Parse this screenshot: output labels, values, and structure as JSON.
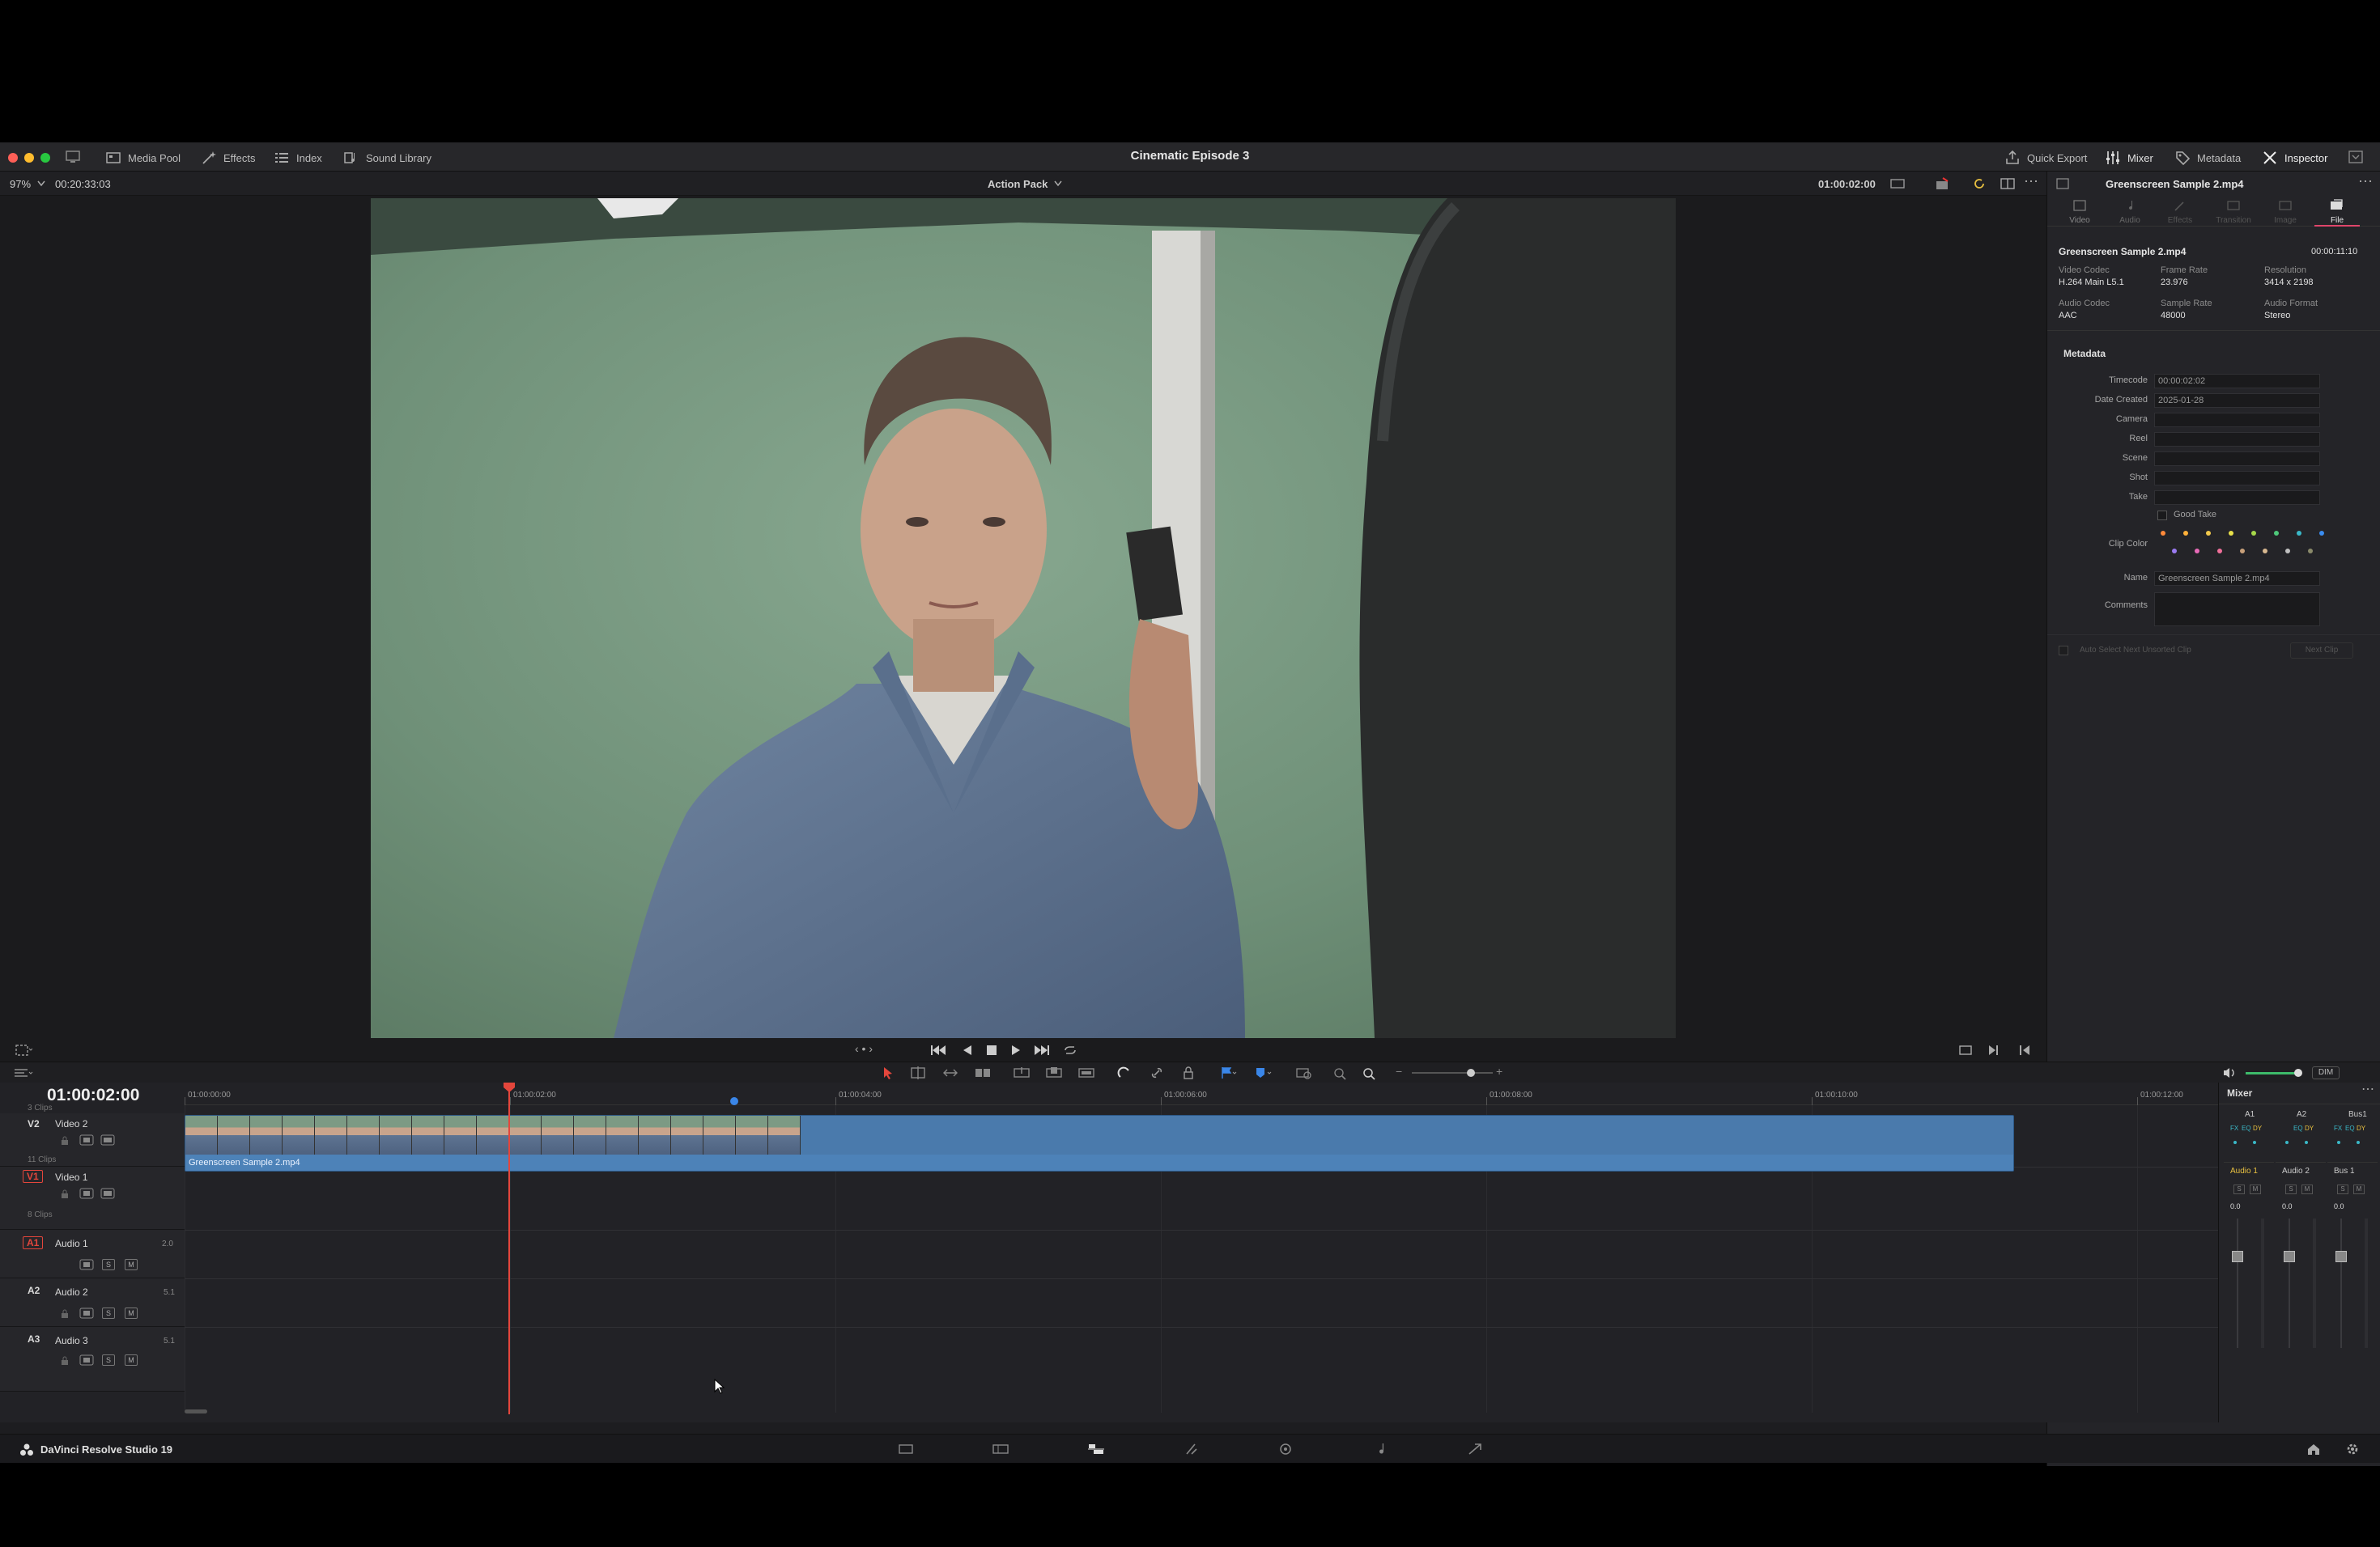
{
  "window": {
    "title": "Cinematic Episode 3"
  },
  "toolbar_left": {
    "media_pool": "Media Pool",
    "effects": "Effects",
    "index": "Index",
    "sound_library": "Sound Library"
  },
  "toolbar_right": {
    "quick_export": "Quick Export",
    "mixer": "Mixer",
    "metadata": "Metadata",
    "inspector": "Inspector"
  },
  "viewer_bar": {
    "zoom": "97%",
    "duration_timecode": "00:20:33:03",
    "preset": "Action Pack",
    "current_timecode": "01:00:02:00"
  },
  "inspector": {
    "clip_title": "Greenscreen Sample 2.mp4",
    "tabs": [
      "Video",
      "Audio",
      "Effects",
      "Transition",
      "Image",
      "File"
    ],
    "active_tab": "File",
    "file_name": "Greenscreen Sample 2.mp4",
    "file_duration": "00:00:11:10",
    "info": [
      {
        "label": "Video Codec",
        "value": "H.264 Main L5.1"
      },
      {
        "label": "Frame Rate",
        "value": "23.976"
      },
      {
        "label": "Resolution",
        "value": "3414 x 2198"
      },
      {
        "label": "Audio Codec",
        "value": "AAC"
      },
      {
        "label": "Sample Rate",
        "value": "48000"
      },
      {
        "label": "Audio Format",
        "value": "Stereo"
      }
    ],
    "metadata_heading": "Metadata",
    "fields": [
      {
        "label": "Timecode",
        "value": "00:00:02:02"
      },
      {
        "label": "Date Created",
        "value": "2025-01-28"
      },
      {
        "label": "Camera",
        "value": ""
      },
      {
        "label": "Reel",
        "value": ""
      },
      {
        "label": "Scene",
        "value": ""
      },
      {
        "label": "Shot",
        "value": ""
      },
      {
        "label": "Take",
        "value": ""
      }
    ],
    "good_take": "Good Take",
    "clip_color_label": "Clip Color",
    "clip_colors": [
      "#ff8a3a",
      "#ffb13a",
      "#f2c94c",
      "#e8e04a",
      "#a6d84a",
      "#4ec87a",
      "#3ab8c8",
      "#3a8cf0",
      "#9a7af0",
      "#e86ab8",
      "#f0709a",
      "#c8a07a",
      "#d8b890",
      "#c0c0c0",
      "#8a8a6a"
    ],
    "name_label": "Name",
    "name_value": "Greenscreen Sample 2.mp4",
    "comments_label": "Comments",
    "auto_select": "Auto Select Next Unsorted Clip",
    "next_clip": "Next Clip"
  },
  "timeline": {
    "timecode": "01:00:02:00",
    "ruler": [
      "01:00:00:00",
      "01:00:02:00",
      "01:00:04:00",
      "01:00:06:00",
      "01:00:08:00",
      "01:00:10:00",
      "01:00:12:00"
    ],
    "v2_clips_count": "3 Clips",
    "v2": {
      "id": "V2",
      "name": "Video 2",
      "clips": "11 Clips"
    },
    "v1": {
      "id": "V1",
      "name": "Video 1",
      "clips": "8 Clips"
    },
    "a1": {
      "id": "A1",
      "name": "Audio 1",
      "format": "2.0"
    },
    "a2": {
      "id": "A2",
      "name": "Audio 2",
      "format": "5.1"
    },
    "a3": {
      "id": "A3",
      "name": "Audio 3",
      "format": "5.1"
    },
    "clip_name": "Greenscreen Sample 2.mp4",
    "s_label": "S",
    "m_label": "M",
    "dim": "DIM"
  },
  "mixer": {
    "title": "Mixer",
    "channels": [
      "A1",
      "A2",
      "Bus1"
    ],
    "fx_labels": [
      "FX",
      "EQ",
      "DY"
    ],
    "strip_names": [
      "Audio 1",
      "Audio 2",
      "Bus 1"
    ],
    "levels": [
      "0.0",
      "0.0",
      "0.0"
    ]
  },
  "footer": {
    "app_name": "DaVinci Resolve Studio 19"
  }
}
